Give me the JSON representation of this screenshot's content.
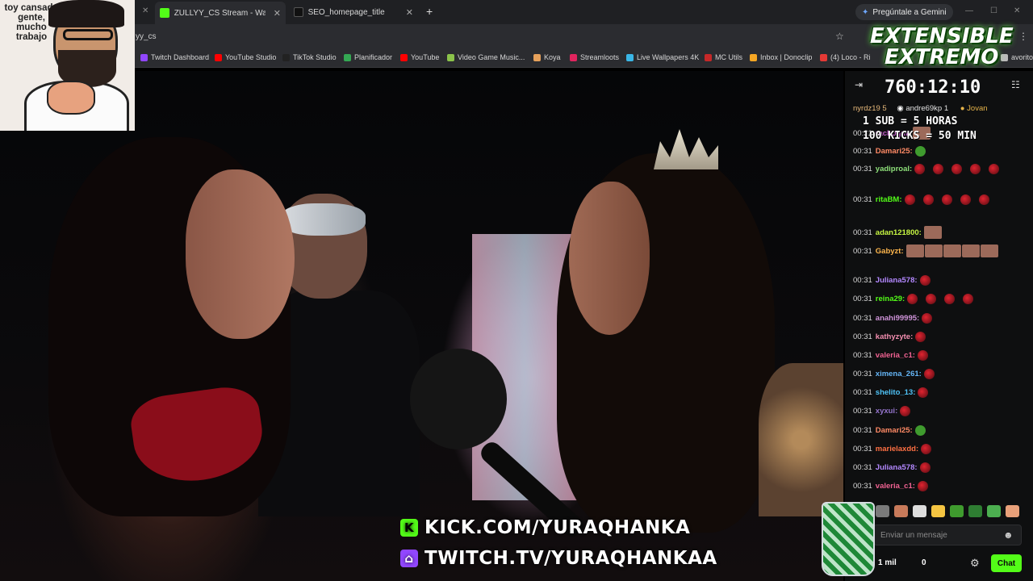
{
  "browser": {
    "tabs": [
      {
        "label": "ZULLYY_CS Stream - Watch Live",
        "color": "#53fc18"
      },
      {
        "label": "SEO_homepage_title",
        "color": "#222"
      }
    ],
    "gemini_label": "Pregúntale a Gemini",
    "url": "yy_cs",
    "bookmarks": [
      {
        "label": "Twitch Dashboard",
        "color": "#9146ff"
      },
      {
        "label": "YouTube Studio",
        "color": "#ff0000"
      },
      {
        "label": "TikTok Studio",
        "color": "#222"
      },
      {
        "label": "Planificador",
        "color": "#34a853"
      },
      {
        "label": "YouTube",
        "color": "#ff0000"
      },
      {
        "label": "Video Game Music...",
        "color": "#8bc34a"
      },
      {
        "label": "Koya",
        "color": "#e6a15b"
      },
      {
        "label": "Streamloots",
        "color": "#e0245e"
      },
      {
        "label": "Live Wallpapers 4K",
        "color": "#3ab6e6"
      },
      {
        "label": "MC Utils",
        "color": "#c62828"
      },
      {
        "label": "Inbox | Donoclip",
        "color": "#f5a623"
      },
      {
        "label": "(4) Loco - Ri",
        "color": "#e53935"
      },
      {
        "label": "avoritos",
        "color": "#bbb"
      }
    ]
  },
  "webcam": {
    "caption": "toy cansado gente, mucho trabajo"
  },
  "stream_overlay": {
    "kick_url": "KICK.COM/YURAQHANKA",
    "twitch_url": "TWITCH.TV/YURAQHANKAA",
    "kick_color": "#53fc18",
    "twitch_color": "#9146ff"
  },
  "promo": {
    "line1": "EXTENSIBLE",
    "line2": "EXTREMO",
    "timer": "760:12:10",
    "sub_rule": "1 SUB = 5 HORAS",
    "kick_rule": "100 KICKS = 50 MIN",
    "accent": "#5dff3d"
  },
  "chat": {
    "top_gifters": [
      "nyrdz19 5",
      "andre69kp 1",
      "Jovan"
    ],
    "messages": [
      {
        "time": "00:31",
        "user": "rachogm:",
        "color": "#c25fc9",
        "emotes": 1,
        "kind": "sq"
      },
      {
        "time": "00:31",
        "user": "Damari25:",
        "color": "#ff8a65",
        "emotes": 1,
        "kind": "pepe"
      },
      {
        "time": "00:31",
        "user": "yadiproal:",
        "color": "#8ee07a",
        "emotes": 5,
        "kind": "orb"
      },
      {
        "time": "00:31",
        "user": "ritaBM:",
        "color": "#53fc18",
        "emotes": 5,
        "kind": "orb"
      },
      {
        "time": "00:31",
        "user": "adan121800:",
        "color": "#c6f542",
        "emotes": 1,
        "kind": "sq"
      },
      {
        "time": "00:31",
        "user": "Gabyzt:",
        "color": "#ffb74d",
        "emotes": 6,
        "kind": "sq"
      },
      {
        "time": "00:31",
        "user": "Juliana578:",
        "color": "#b388ff",
        "emotes": 1,
        "kind": "orb"
      },
      {
        "time": "00:31",
        "user": "reina29:",
        "color": "#53fc18",
        "emotes": 4,
        "kind": "orb"
      },
      {
        "time": "00:31",
        "user": "anahi99995:",
        "color": "#ce93d8",
        "emotes": 1,
        "kind": "orb"
      },
      {
        "time": "00:31",
        "user": "kathyzyte:",
        "color": "#f48fb1",
        "emotes": 1,
        "kind": "orb"
      },
      {
        "time": "00:31",
        "user": "valeria_c1:",
        "color": "#f06292",
        "emotes": 1,
        "kind": "orb"
      },
      {
        "time": "00:31",
        "user": "ximena_261:",
        "color": "#64b5f6",
        "emotes": 1,
        "kind": "orb"
      },
      {
        "time": "00:31",
        "user": "shelito_13:",
        "color": "#4fc3f7",
        "emotes": 1,
        "kind": "orb"
      },
      {
        "time": "00:31",
        "user": "xyxui:",
        "color": "#9575cd",
        "emotes": 1,
        "kind": "orb"
      },
      {
        "time": "00:31",
        "user": "Damari25:",
        "color": "#ff8a65",
        "emotes": 1,
        "kind": "pepe"
      },
      {
        "time": "00:31",
        "user": "marielaxdd:",
        "color": "#ff7043",
        "emotes": 1,
        "kind": "orb"
      },
      {
        "time": "00:31",
        "user": "Juliana578:",
        "color": "#b388ff",
        "emotes": 1,
        "kind": "orb"
      },
      {
        "time": "00:31",
        "user": "valeria_c1:",
        "color": "#f06292",
        "emotes": 1,
        "kind": "orb"
      }
    ],
    "input_placeholder": "Enviar un mensaje",
    "viewers": "1 mil",
    "points": "0",
    "send_label": "Chat"
  }
}
